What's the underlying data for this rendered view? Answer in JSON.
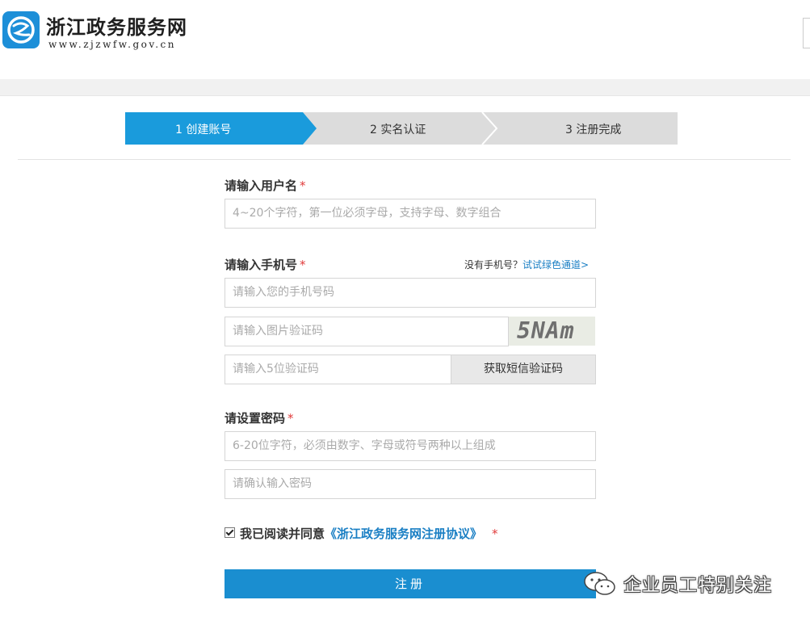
{
  "header": {
    "site_title": "浙江政务服务网",
    "site_url": "www.zjzwfw.gov.cn"
  },
  "steps": [
    {
      "label": "1 创建账号",
      "active": true
    },
    {
      "label": "2 实名认证",
      "active": false
    },
    {
      "label": "3 注册完成",
      "active": false
    }
  ],
  "form": {
    "username_label": "请输入用户名",
    "username_placeholder": "4~20个字符，第一位必须字母，支持字母、数字组合",
    "phone_label": "请输入手机号",
    "no_phone_text": "没有手机号？",
    "green_channel_link": "试试绿色通道>",
    "phone_placeholder": "请输入您的手机号码",
    "image_code_placeholder": "请输入图片验证码",
    "captcha_text": "5NAm",
    "sms_code_placeholder": "请输入5位验证码",
    "sms_button_label": "获取短信验证码",
    "password_label": "请设置密码",
    "password_placeholder": "6-20位字符，必须由数字、字母或符号两种以上组成",
    "confirm_password_placeholder": "请确认输入密码",
    "required_mark": "*",
    "agree_text": "我已阅读并同意",
    "agreement_link": "《浙江政务服务网注册协议》",
    "agree_checked": true,
    "register_button_label": "注册"
  },
  "watermark": {
    "text": "企业员工特别关注"
  },
  "colors": {
    "accent": "#1a9bdc",
    "step_inactive": "#dcdcdc",
    "link": "#1a7fc4",
    "required": "#e03b3b"
  }
}
